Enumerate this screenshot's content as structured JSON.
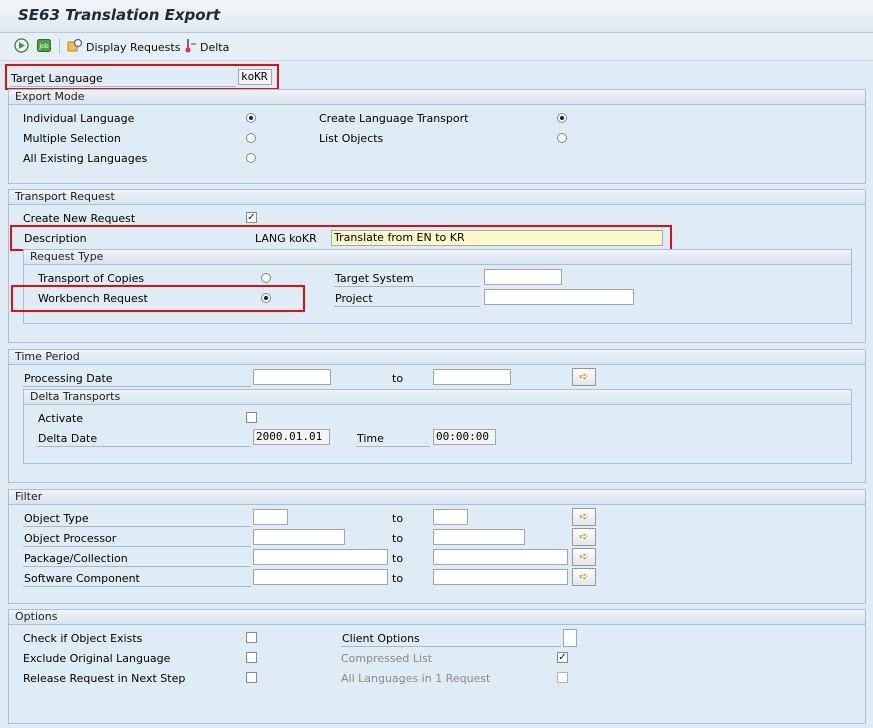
{
  "window": {
    "title": "SE63 Translation Export"
  },
  "toolbar": {
    "display_requests": "Display Requests",
    "delta": "Delta"
  },
  "target_language": {
    "label": "Target Language",
    "value": "koKR"
  },
  "export_mode": {
    "title": "Export Mode",
    "individual_language": "Individual Language",
    "multiple_selection": "Multiple Selection",
    "all_existing_languages": "All Existing Languages",
    "create_language_transport": "Create Language Transport",
    "list_objects": "List Objects"
  },
  "transport_request": {
    "title": "Transport Request",
    "create_new_request": "Create New Request",
    "description_label": "Description",
    "description_prefix": "LANG koKR",
    "description_value": "Translate from EN to KR",
    "request_type": {
      "title": "Request Type",
      "transport_of_copies": "Transport of Copies",
      "workbench_request": "Workbench Request",
      "target_system": "Target System",
      "project": "Project"
    }
  },
  "time_period": {
    "title": "Time Period",
    "processing_date": "Processing Date",
    "to": "to",
    "delta_transports": {
      "title": "Delta Transports",
      "activate": "Activate",
      "delta_date_label": "Delta Date",
      "delta_date_value": "2000.01.01",
      "time_label": "Time",
      "time_value": "00:00:00"
    }
  },
  "filter": {
    "title": "Filter",
    "object_type": "Object Type",
    "object_processor": "Object Processor",
    "package_collection": "Package/Collection",
    "software_component": "Software Component",
    "to": "to"
  },
  "options": {
    "title": "Options",
    "check_if_object_exists": "Check if Object Exists",
    "exclude_original_language": "Exclude Original Language",
    "release_request_next_step": "Release Request in Next Step",
    "client_options": "Client Options",
    "compressed_list": "Compressed List",
    "all_languages_one_request": "All Languages in 1 Request"
  },
  "colors": {
    "highlight": "#e01010",
    "background": "#dfebf5",
    "required_field": "#fff9c8"
  }
}
